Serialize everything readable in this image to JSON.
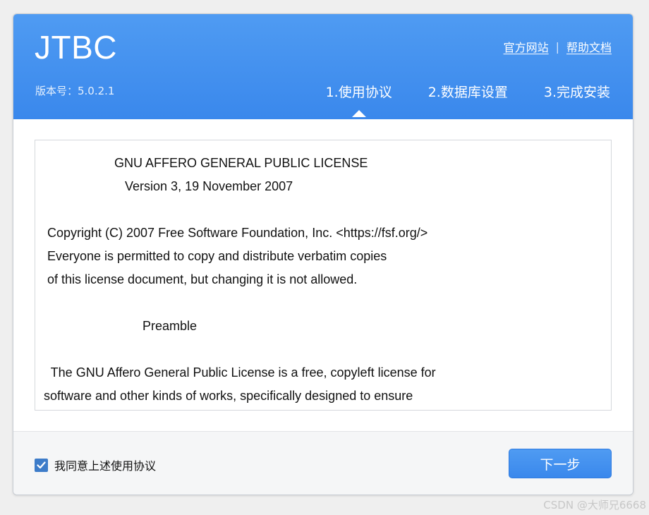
{
  "header": {
    "logo": "JTBC",
    "version": "版本号：5.0.2.1",
    "links": {
      "official_site": "官方网站",
      "separator": "|",
      "help_docs": "帮助文档"
    },
    "steps": [
      {
        "label": "1.使用协议",
        "active": true
      },
      {
        "label": "2.数据库设置",
        "active": false
      },
      {
        "label": "3.完成安装",
        "active": false
      }
    ]
  },
  "license": {
    "lines": [
      "                    GNU AFFERO GENERAL PUBLIC LICENSE",
      "                       Version 3, 19 November 2007",
      "",
      " Copyright (C) 2007 Free Software Foundation, Inc. <https://fsf.org/>",
      " Everyone is permitted to copy and distribute verbatim copies",
      " of this license document, but changing it is not allowed.",
      "",
      "                            Preamble",
      "",
      "  The GNU Affero General Public License is a free, copyleft license for",
      "software and other kinds of works, specifically designed to ensure"
    ]
  },
  "footer": {
    "agree_label": "我同意上述使用协议",
    "agree_checked": true,
    "next_label": "下一步"
  },
  "watermark": "CSDN @大师兄6668",
  "colors": {
    "header_blue": "#4f9bf2",
    "checkbox_blue": "#3d7cc9",
    "button_blue": "#3a88ec"
  }
}
